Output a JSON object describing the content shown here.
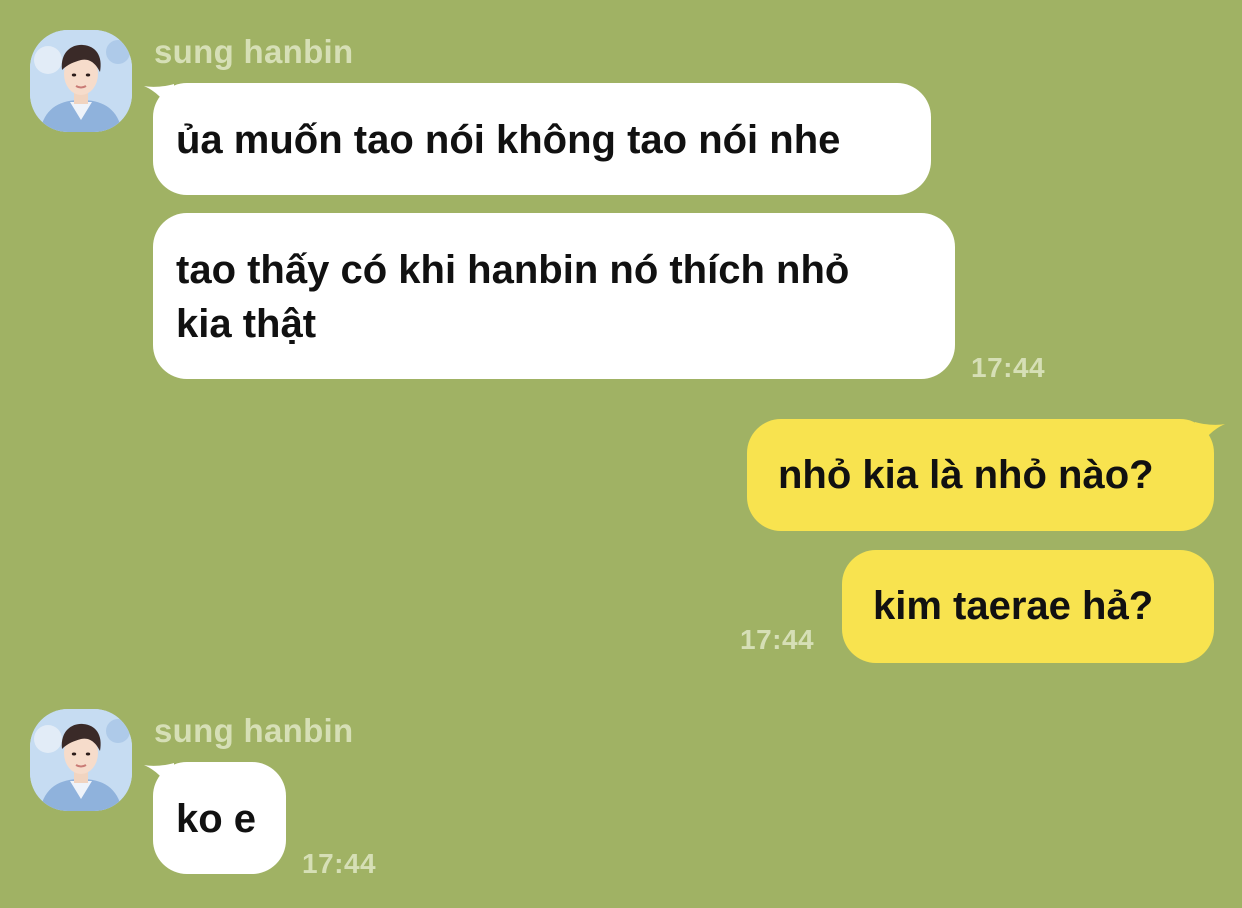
{
  "colors": {
    "background": "#a0b264",
    "incoming_bubble": "#ffffff",
    "outgoing_bubble": "#f8e34f",
    "meta_text": "#d6dfb6"
  },
  "messages": [
    {
      "sender": "sung hanbin",
      "avatar_icon": "profile-photo",
      "bubbles": [
        "ủa muốn tao nói không tao nói nhe"
      ]
    },
    {
      "bubbles": [
        "tao thấy có khi hanbin nó thích nhỏ",
        "kia thật"
      ],
      "time": "17:44"
    },
    {
      "bubbles": [
        "nhỏ kia là nhỏ nào?"
      ]
    },
    {
      "bubbles": [
        "kim taerae hả?"
      ],
      "time": "17:44"
    },
    {
      "sender": "sung hanbin",
      "avatar_icon": "profile-photo",
      "bubbles": [
        "ko e"
      ],
      "time": "17:44"
    }
  ]
}
